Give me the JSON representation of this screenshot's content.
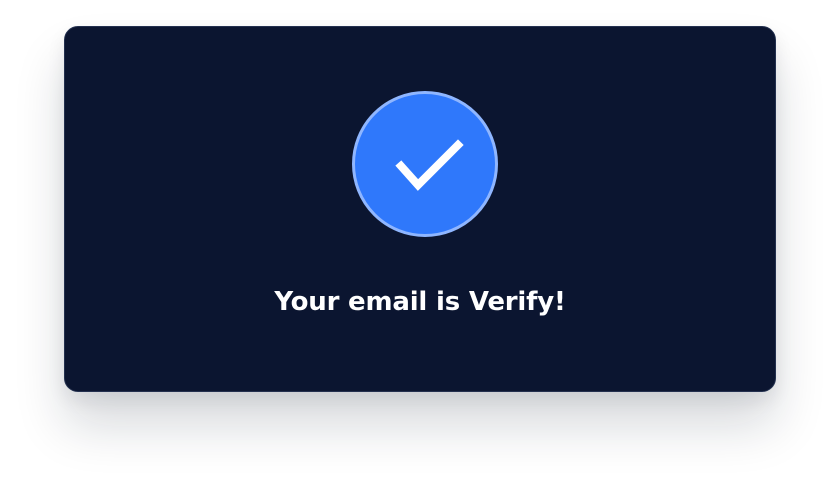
{
  "dialog": {
    "icon": "checkmark-icon",
    "message": "Your email is Verify!",
    "colors": {
      "background": "#0b1530",
      "accent": "#2f78fb",
      "accent_border": "#8fb6ff",
      "text": "#ffffff"
    }
  }
}
